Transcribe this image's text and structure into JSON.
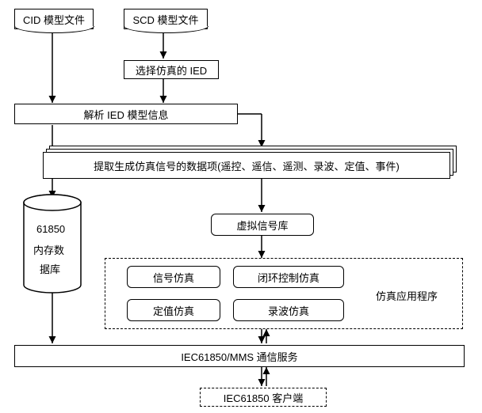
{
  "files": {
    "cid": "CID 模型文件",
    "scd": "SCD 模型文件"
  },
  "steps": {
    "select_ied": "选择仿真的 IED",
    "parse_ied": "解析 IED 模型信息",
    "extract_items": "提取生成仿真信号的数据项(遥控、遥信、遥测、录波、定值、事件)",
    "virtual_lib": "虚拟信号库",
    "comm_service": "IEC61850/MMS 通信服务",
    "client": "IEC61850 客户端"
  },
  "db": {
    "line1": "61850",
    "line2": "内存数",
    "line3": "据库"
  },
  "apps": {
    "signal": "信号仿真",
    "closed_loop": "闭环控制仿真",
    "setpoint": "定值仿真",
    "waveform": "录波仿真",
    "group_label": "仿真应用程序"
  }
}
